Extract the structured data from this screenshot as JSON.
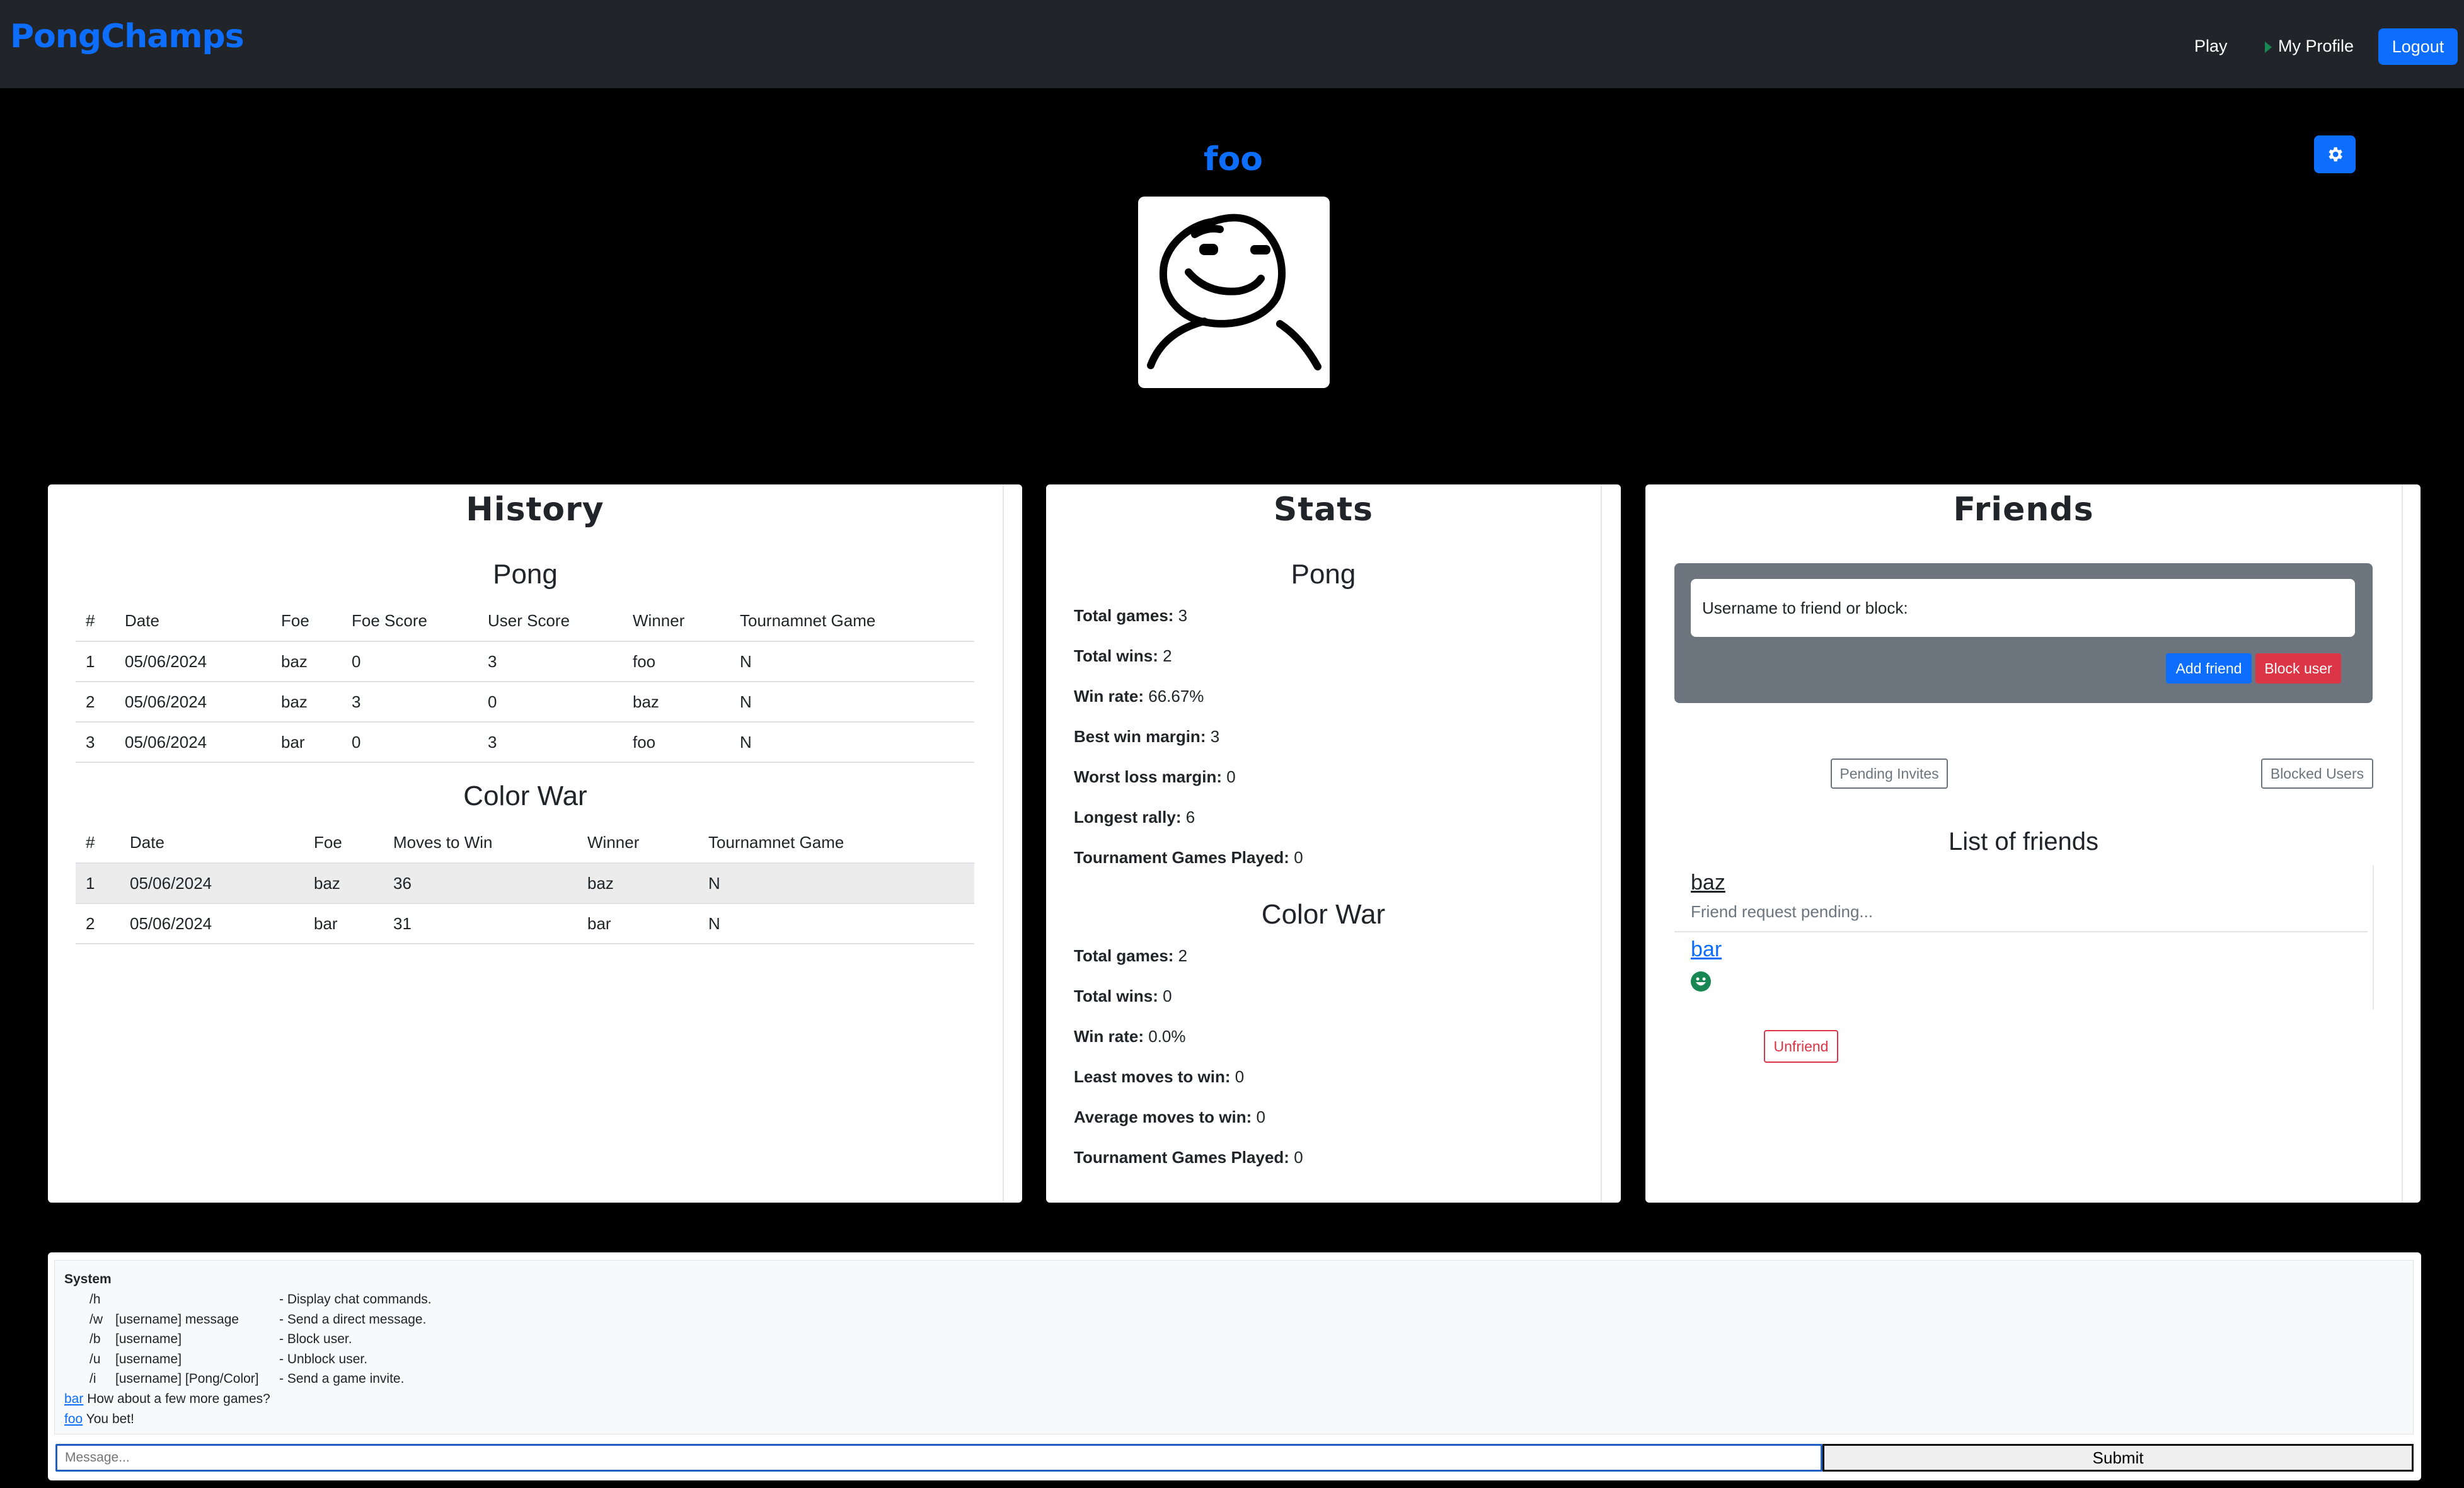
{
  "navbar": {
    "brand": "PongChamps",
    "play": "Play",
    "my_profile": "My Profile",
    "logout": "Logout"
  },
  "profile": {
    "username": "foo",
    "settings_icon": "gear-icon"
  },
  "history": {
    "title": "History",
    "pong": {
      "title": "Pong",
      "columns": [
        "#",
        "Date",
        "Foe",
        "Foe Score",
        "User Score",
        "Winner",
        "Tournamnet Game"
      ],
      "rows": [
        [
          "1",
          "05/06/2024",
          "baz",
          "0",
          "3",
          "foo",
          "N"
        ],
        [
          "2",
          "05/06/2024",
          "baz",
          "3",
          "0",
          "baz",
          "N"
        ],
        [
          "3",
          "05/06/2024",
          "bar",
          "0",
          "3",
          "foo",
          "N"
        ]
      ]
    },
    "colorwar": {
      "title": "Color War",
      "columns": [
        "#",
        "Date",
        "Foe",
        "Moves to Win",
        "Winner",
        "Tournamnet Game"
      ],
      "rows": [
        [
          "1",
          "05/06/2024",
          "baz",
          "36",
          "baz",
          "N"
        ],
        [
          "2",
          "05/06/2024",
          "bar",
          "31",
          "bar",
          "N"
        ]
      ]
    }
  },
  "stats": {
    "title": "Stats",
    "pong": {
      "title": "Pong",
      "items": [
        {
          "label": "Total games:",
          "value": "3"
        },
        {
          "label": "Total wins:",
          "value": "2"
        },
        {
          "label": "Win rate:",
          "value": "66.67%"
        },
        {
          "label": "Best win margin:",
          "value": "3"
        },
        {
          "label": "Worst loss margin:",
          "value": "0"
        },
        {
          "label": "Longest rally:",
          "value": "6"
        },
        {
          "label": "Tournament Games Played:",
          "value": "0"
        }
      ]
    },
    "colorwar": {
      "title": "Color War",
      "items": [
        {
          "label": "Total games:",
          "value": "2"
        },
        {
          "label": "Total wins:",
          "value": "0"
        },
        {
          "label": "Win rate:",
          "value": "0.0%"
        },
        {
          "label": "Least moves to win:",
          "value": "0"
        },
        {
          "label": "Average moves to win:",
          "value": "0"
        },
        {
          "label": "Tournament Games Played:",
          "value": "0"
        }
      ]
    }
  },
  "friends": {
    "title": "Friends",
    "input_label": "Username to friend or block:",
    "add_friend": "Add friend",
    "block_user": "Block user",
    "pending_invites": "Pending Invites",
    "blocked_users": "Blocked Users",
    "list_title": "List of friends",
    "list": [
      {
        "name": "baz",
        "status": "Friend request pending..."
      },
      {
        "name": "bar",
        "status_icon": "smiley-online-icon",
        "action": "Unfriend"
      }
    ]
  },
  "chat": {
    "system_label": "System",
    "commands": [
      {
        "cmd": "/h",
        "args": "",
        "desc": "- Display chat commands."
      },
      {
        "cmd": "/w",
        "args": "[username] message",
        "desc": "- Send a direct message."
      },
      {
        "cmd": "/b",
        "args": "[username]",
        "desc": "- Block user."
      },
      {
        "cmd": "/u",
        "args": "[username]",
        "desc": "- Unblock user."
      },
      {
        "cmd": "/i",
        "args": "[username] [Pong/Color]",
        "desc": "- Send a game invite."
      }
    ],
    "messages": [
      {
        "user": "bar",
        "text": "How about a few more games?"
      },
      {
        "user": "foo",
        "text": "You bet!"
      }
    ],
    "input_placeholder": "Message...",
    "submit": "Submit"
  },
  "colors": {
    "primary": "#0d6efd",
    "danger": "#dc3545",
    "secondary": "#6c757d",
    "navbar_bg": "#212529",
    "online": "#198754"
  }
}
